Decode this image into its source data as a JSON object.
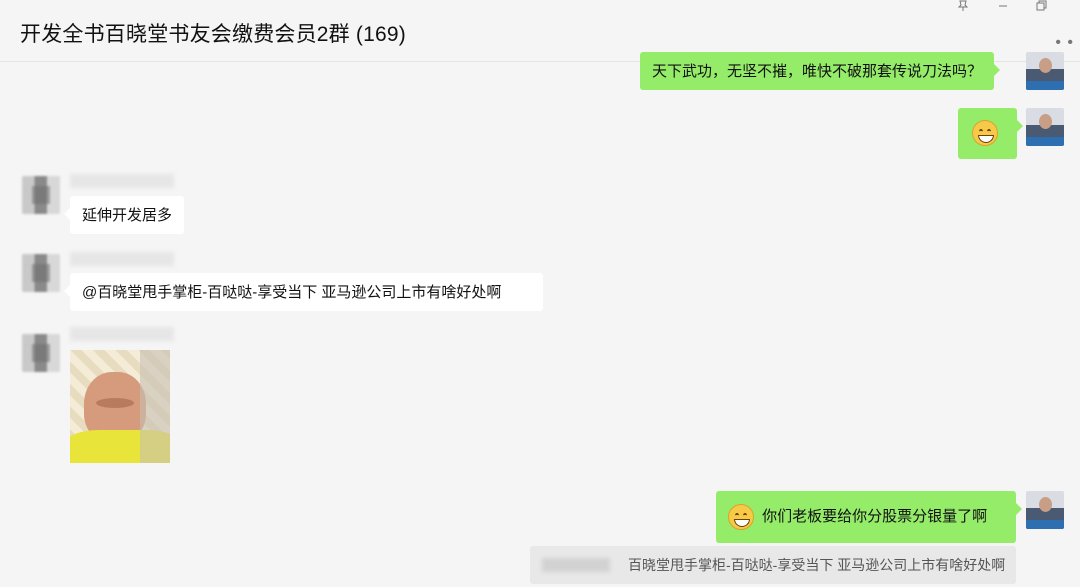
{
  "header": {
    "title": "开发全书百晓堂书友会缴费会员2群 (169)",
    "pin_icon": "pin-icon",
    "minimize_icon": "minimize-icon",
    "restore_icon": "restore-icon",
    "more_icon": "more-icon"
  },
  "messages": [
    {
      "side": "right",
      "type": "text",
      "text": "天下武功，无坚不摧，唯快不破那套传说刀法吗？"
    },
    {
      "side": "right",
      "type": "emoji",
      "emoji": "grinning-face-icon"
    },
    {
      "side": "left",
      "type": "text",
      "text": "延伸开发居多"
    },
    {
      "side": "left",
      "type": "text",
      "text": "@百晓堂甩手掌柜-百哒哒-享受当下 亚马逊公司上市有啥好处啊"
    },
    {
      "side": "left",
      "type": "image",
      "image": "meme-photo"
    },
    {
      "side": "right",
      "type": "text",
      "emoji": "grinning-face-icon",
      "text": "你们老板要给你分股票分银量了啊"
    }
  ],
  "quote": {
    "text": "百晓堂甩手掌柜-百哒哒-享受当下 亚马逊公司上市有啥好处啊"
  }
}
